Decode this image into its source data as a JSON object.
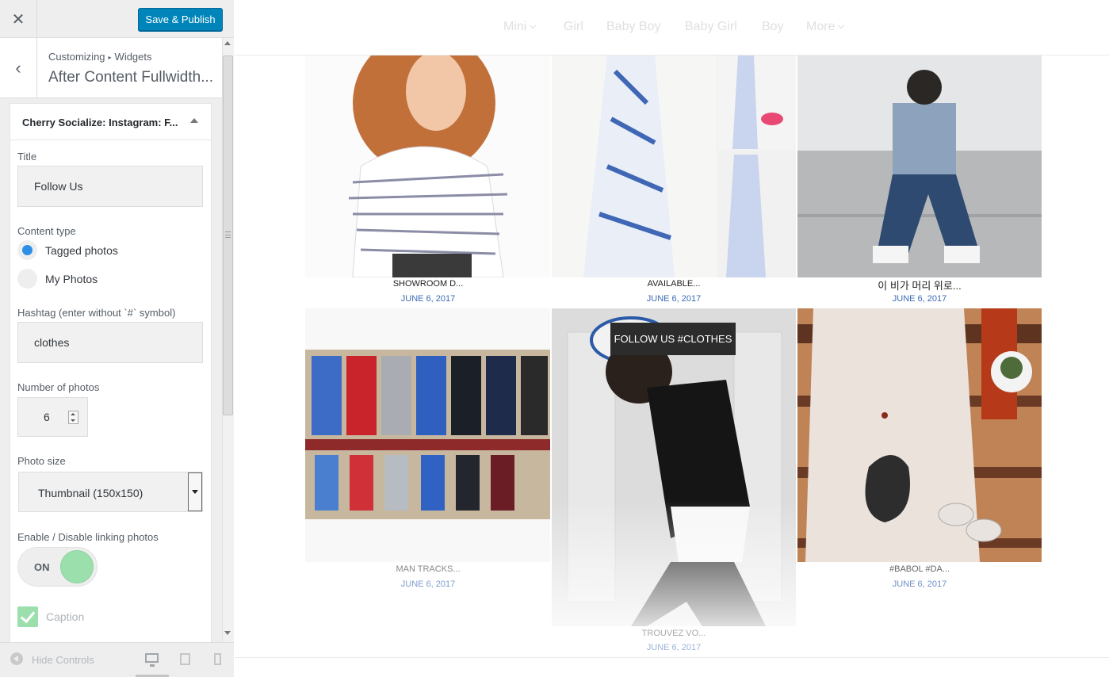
{
  "header": {
    "close_glyph": "✕",
    "publish_label": "Save & Publish"
  },
  "section": {
    "back_glyph": "‹",
    "crumb_root": "Customizing",
    "crumb_sep": "▸",
    "crumb_child": "Widgets",
    "title": "After Content Fullwidth..."
  },
  "widget": {
    "title": "Cherry Socialize: Instagram: F...",
    "title_label": "Title",
    "title_value": "Follow Us",
    "content_type_label": "Content type",
    "content_types": [
      {
        "label": "Tagged photos",
        "checked": true
      },
      {
        "label": "My Photos",
        "checked": false
      }
    ],
    "hashtag_label": "Hashtag (enter without `#` symbol)",
    "hashtag_value": "clothes",
    "number_label": "Number of photos",
    "number_value": "6",
    "photo_size_label": "Photo size",
    "photo_size_value": "Thumbnail (150x150)",
    "linking_label": "Enable / Disable linking photos",
    "linking_state": "ON",
    "caption_label": "Caption"
  },
  "footer": {
    "hide_label": "Hide Controls"
  },
  "preview": {
    "nav": [
      {
        "label": "Mini",
        "dropdown": true
      },
      {
        "label": "Girl",
        "dropdown": false
      },
      {
        "label": "Baby Boy",
        "dropdown": false
      },
      {
        "label": "Baby Girl",
        "dropdown": false
      },
      {
        "label": "Boy",
        "dropdown": false
      },
      {
        "label": "More",
        "dropdown": true
      }
    ],
    "follow_badge": "FOLLOW US #CLOTHES",
    "photos": [
      {
        "caption": "SHOWROOM D...",
        "date": "JUNE 6, 2017"
      },
      {
        "caption": "AVAILABLE...",
        "date": "JUNE 6, 2017"
      },
      {
        "caption": "이 비가 머리 위로...",
        "date": "JUNE 6, 2017"
      },
      {
        "caption": "MAN TRACKS...",
        "date": "JUNE 6, 2017"
      },
      {
        "caption": "TROUVEZ VO...",
        "date": "JUNE 6, 2017"
      },
      {
        "caption": "#BABOL #DA...",
        "date": "JUNE 6, 2017"
      }
    ]
  }
}
